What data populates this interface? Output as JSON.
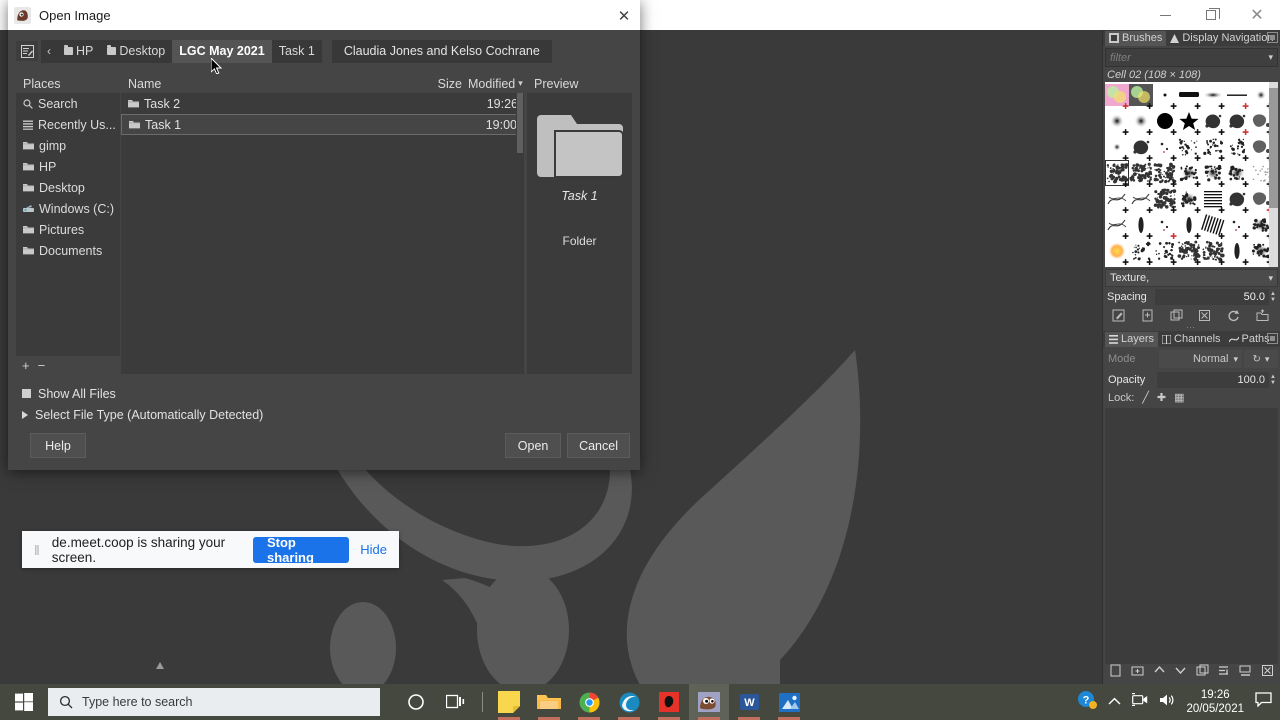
{
  "window": {
    "controls": {
      "minimize": "minimize-icon",
      "restore": "restore-icon",
      "close": "close-icon"
    }
  },
  "dialog": {
    "title": "Open Image",
    "app_icon": "gimp-wilber-icon",
    "close_label": "✕",
    "path_bar": {
      "type_path_icon": "type-a-file-name-icon",
      "back_label": "‹",
      "crumbs": [
        {
          "label": "HP",
          "icon": "folder-icon",
          "active": false
        },
        {
          "label": "Desktop",
          "icon": "folder-icon",
          "active": false
        },
        {
          "label": "LGC May 2021",
          "icon": "",
          "active": true
        },
        {
          "label": "Task 1",
          "icon": "",
          "active": false
        }
      ],
      "extra_crumb": "Claudia Jones and Kelso Cochrane"
    },
    "places": {
      "header": "Places",
      "items": [
        {
          "label": "Search",
          "icon": "search-icon"
        },
        {
          "label": "Recently Us...",
          "icon": "recent-icon"
        },
        {
          "label": "gimp",
          "icon": "folder-icon"
        },
        {
          "label": "HP",
          "icon": "folder-icon"
        },
        {
          "label": "Desktop",
          "icon": "folder-icon"
        },
        {
          "label": "Windows (C:)",
          "icon": "drive-icon"
        },
        {
          "label": "Pictures",
          "icon": "folder-icon"
        },
        {
          "label": "Documents",
          "icon": "folder-icon"
        }
      ],
      "add_label": "+",
      "remove_label": "−"
    },
    "file_list": {
      "columns": {
        "name": "Name",
        "size": "Size",
        "modified": "Modified"
      },
      "sort_indicator": "chevron-down-icon",
      "rows": [
        {
          "name": "Task 2",
          "size": "",
          "modified": "19:26",
          "selected": false
        },
        {
          "name": "Task 1",
          "size": "",
          "modified": "19:00",
          "selected": true
        }
      ]
    },
    "preview": {
      "header": "Preview",
      "icon": "folder-icon-large",
      "name": "Task 1",
      "type": "Folder"
    },
    "options": {
      "show_all_files": "Show All Files",
      "select_file_type": "Select File Type (Automatically Detected)"
    },
    "buttons": {
      "help": "Help",
      "open": "Open",
      "cancel": "Cancel"
    }
  },
  "dock": {
    "brushes_panel": {
      "tabs": [
        {
          "label": "Brushes",
          "icon": "brushes-icon",
          "active": true
        },
        {
          "label": "Display Navigation",
          "icon": "navigation-icon",
          "active": false
        }
      ],
      "menu_button": "dock-menu-icon",
      "filter_placeholder": "filter",
      "filter_value": "",
      "selected_brush_label": "Cell 02 (108 × 108)",
      "texture_label": "Texture,",
      "spacing_label": "Spacing",
      "spacing_value": "50.0",
      "toolbar_icons": [
        "edit-brush-icon",
        "new-brush-icon",
        "duplicate-brush-icon",
        "delete-brush-icon",
        "refresh-brushes-icon",
        "open-brush-folder-icon"
      ]
    },
    "layers_panel": {
      "tabs": [
        {
          "label": "Layers",
          "icon": "layers-icon",
          "active": true
        },
        {
          "label": "Channels",
          "icon": "channels-icon",
          "active": false
        },
        {
          "label": "Paths",
          "icon": "paths-icon",
          "active": false
        }
      ],
      "menu_button": "dock-menu-icon",
      "mode_label": "Mode",
      "mode_value": "Normal",
      "mode_reset_icon": "reset-icon",
      "opacity_label": "Opacity",
      "opacity_value": "100.0",
      "lock_label": "Lock:",
      "lock_icons": [
        "lock-pixels-icon",
        "lock-position-icon",
        "lock-alpha-icon"
      ],
      "bottom_icons": [
        "new-layer-icon",
        "new-layer-group-icon",
        "raise-layer-icon",
        "lower-layer-icon",
        "duplicate-layer-icon",
        "anchor-layer-icon",
        "merge-down-icon",
        "delete-layer-icon"
      ]
    }
  },
  "share_bar": {
    "grip": "drag-handle-icon",
    "message": "de.meet.coop is sharing your screen.",
    "stop_label": "Stop sharing",
    "hide_label": "Hide",
    "accent": "#1a73e8"
  },
  "taskbar": {
    "start_icon": "windows-start-icon",
    "search_placeholder": "Type here to search",
    "search_icon": "search-icon",
    "cortana_icon": "cortana-icon",
    "taskview_icon": "task-view-icon",
    "apps": [
      {
        "name": "sticky-notes-icon",
        "running": true,
        "active": false
      },
      {
        "name": "file-explorer-icon",
        "running": true,
        "active": false
      },
      {
        "name": "google-chrome-icon",
        "running": true,
        "active": false
      },
      {
        "name": "microsoft-edge-icon",
        "running": true,
        "active": false
      },
      {
        "name": "red-app-icon",
        "running": true,
        "active": false
      },
      {
        "name": "gimp-icon",
        "running": true,
        "active": true
      },
      {
        "name": "microsoft-word-icon",
        "running": true,
        "active": false
      },
      {
        "name": "photos-icon",
        "running": true,
        "active": false
      }
    ],
    "tray": {
      "help_icon": "help-question-icon",
      "overflow_icon": "show-hidden-icons-icon",
      "camera_icon": "screen-share-camera-icon",
      "volume_icon": "volume-icon",
      "action_center_icon": "action-center-icon"
    },
    "clock": {
      "time": "19:26",
      "date": "20/05/2021"
    }
  }
}
